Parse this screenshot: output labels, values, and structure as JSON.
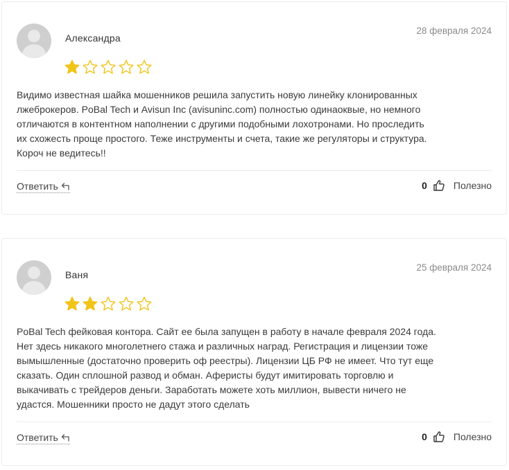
{
  "colors": {
    "star_filled": "#f0c419",
    "star_empty": "#f0c419",
    "text": "#3a3a3a",
    "date": "#8a8a8a",
    "border": "#ececec"
  },
  "reviews": [
    {
      "author": "Александра",
      "date": "28 февраля 2024",
      "rating": 1,
      "max_rating": 5,
      "text_lines": [
        "Видимо известная шайка мошенников решила запустить новую линейку клонированных",
        "лжеброкеров. PoBal Tech и Avisun Inc (avisuninc.com) полностью одинаоквые, но немного",
        "отличаются в контентном наполнении с другими подобными лохотронами. Но проследить",
        "их схожесть проще простого. Теже инструменты и счета, такие же регуляторы и структура.",
        "Короч не ведитесь!!"
      ],
      "reply_label": "Ответить",
      "reply_icon": "reply-arrow-icon",
      "like_count": "0",
      "like_icon": "thumbs-up-icon",
      "helpful_label": "Полезно"
    },
    {
      "author": "Ваня",
      "date": "25 февраля 2024",
      "rating": 2,
      "max_rating": 5,
      "text_lines": [
        "PoBal Tech фейковая контора. Сайт ее была запущен в работу в начале февраля 2024 года.",
        "Нет здесь никакого многолетнего стажа и различных наград. Регистрация и лицензии тоже",
        "вымышленные (достаточно проверить оф реестры). Лицензии ЦБ РФ не имеет. Что тут еще",
        "сказать. Один сплошной развод и обман. Аферисты будут имитировать торговлю и",
        "выкачивать с трейдеров деньги. Заработать можете хоть миллион, вывести ничего не",
        "удастся. Мошенники просто не дадут этого сделать"
      ],
      "reply_label": "Ответить",
      "reply_icon": "reply-arrow-icon",
      "like_count": "0",
      "like_icon": "thumbs-up-icon",
      "helpful_label": "Полезно"
    }
  ]
}
